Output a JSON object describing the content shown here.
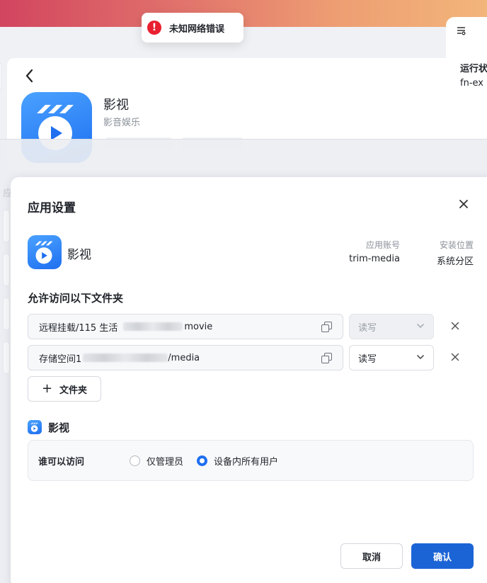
{
  "toast": {
    "message": "未知网络错误",
    "icon": "error-icon",
    "color": "#e8202f"
  },
  "background": {
    "app_name": "影视",
    "app_category": "影音娱乐",
    "right_panel": {
      "title": "运行状",
      "subtitle": "fn-ex"
    },
    "side_label": "应"
  },
  "dialog": {
    "title": "应用设置",
    "app": {
      "name": "影视",
      "account_label": "应用账号",
      "account_value": "trim-media",
      "location_label": "安装位置",
      "location_value": "系统分区"
    },
    "folders_title": "允许访问以下文件夹",
    "folders": [
      {
        "path_prefix": "远程挂载/115 生活",
        "path_suffix": "movie",
        "permission": "读写",
        "permission_disabled": true
      },
      {
        "path_prefix": "存储空间1",
        "path_suffix": "/media",
        "permission": "读写",
        "permission_disabled": false
      }
    ],
    "add_folder_label": "文件夹",
    "access": {
      "app_name": "影视",
      "label": "谁可以访问",
      "options": [
        {
          "label": "仅管理员",
          "checked": false
        },
        {
          "label": "设备内所有用户",
          "checked": true
        }
      ]
    },
    "cancel_label": "取消",
    "confirm_label": "确认"
  },
  "colors": {
    "accent": "#1b64d6",
    "error": "#e8202f",
    "gradient_start": "#d2455f",
    "gradient_end": "#f2b57a"
  }
}
